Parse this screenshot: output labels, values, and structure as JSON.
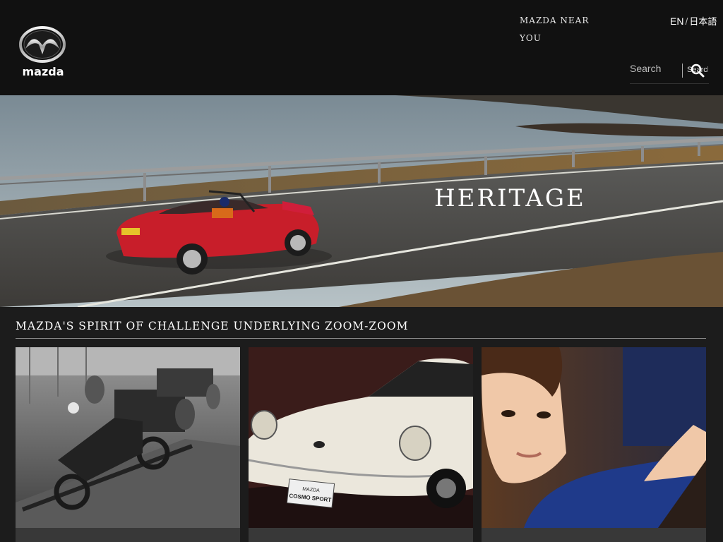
{
  "header": {
    "logo_text": "mazda",
    "near_you_label": "MAZDA NEAR YOU",
    "lang_en": "EN",
    "lang_separator": "/",
    "lang_jp": "日本語",
    "search": {
      "placeholder": "Search",
      "button_label": "Search"
    }
  },
  "hero": {
    "title": "HERITAGE"
  },
  "section": {
    "title": "MAZDA'S SPIRIT OF CHALLENGE UNDERLYING ZOOM-ZOOM",
    "cards": [
      {
        "image": "vintage-factory-photo"
      },
      {
        "image": "cosmo-sport-car-photo",
        "plate_line1": "MAZDA",
        "plate_line2": "COSMO SPORT"
      },
      {
        "image": "worker-portrait-photo"
      }
    ]
  },
  "colors": {
    "header_bg": "#111111",
    "page_bg": "#1c1c1c",
    "text": "#ffffff",
    "rule": "#8a8a8a"
  }
}
